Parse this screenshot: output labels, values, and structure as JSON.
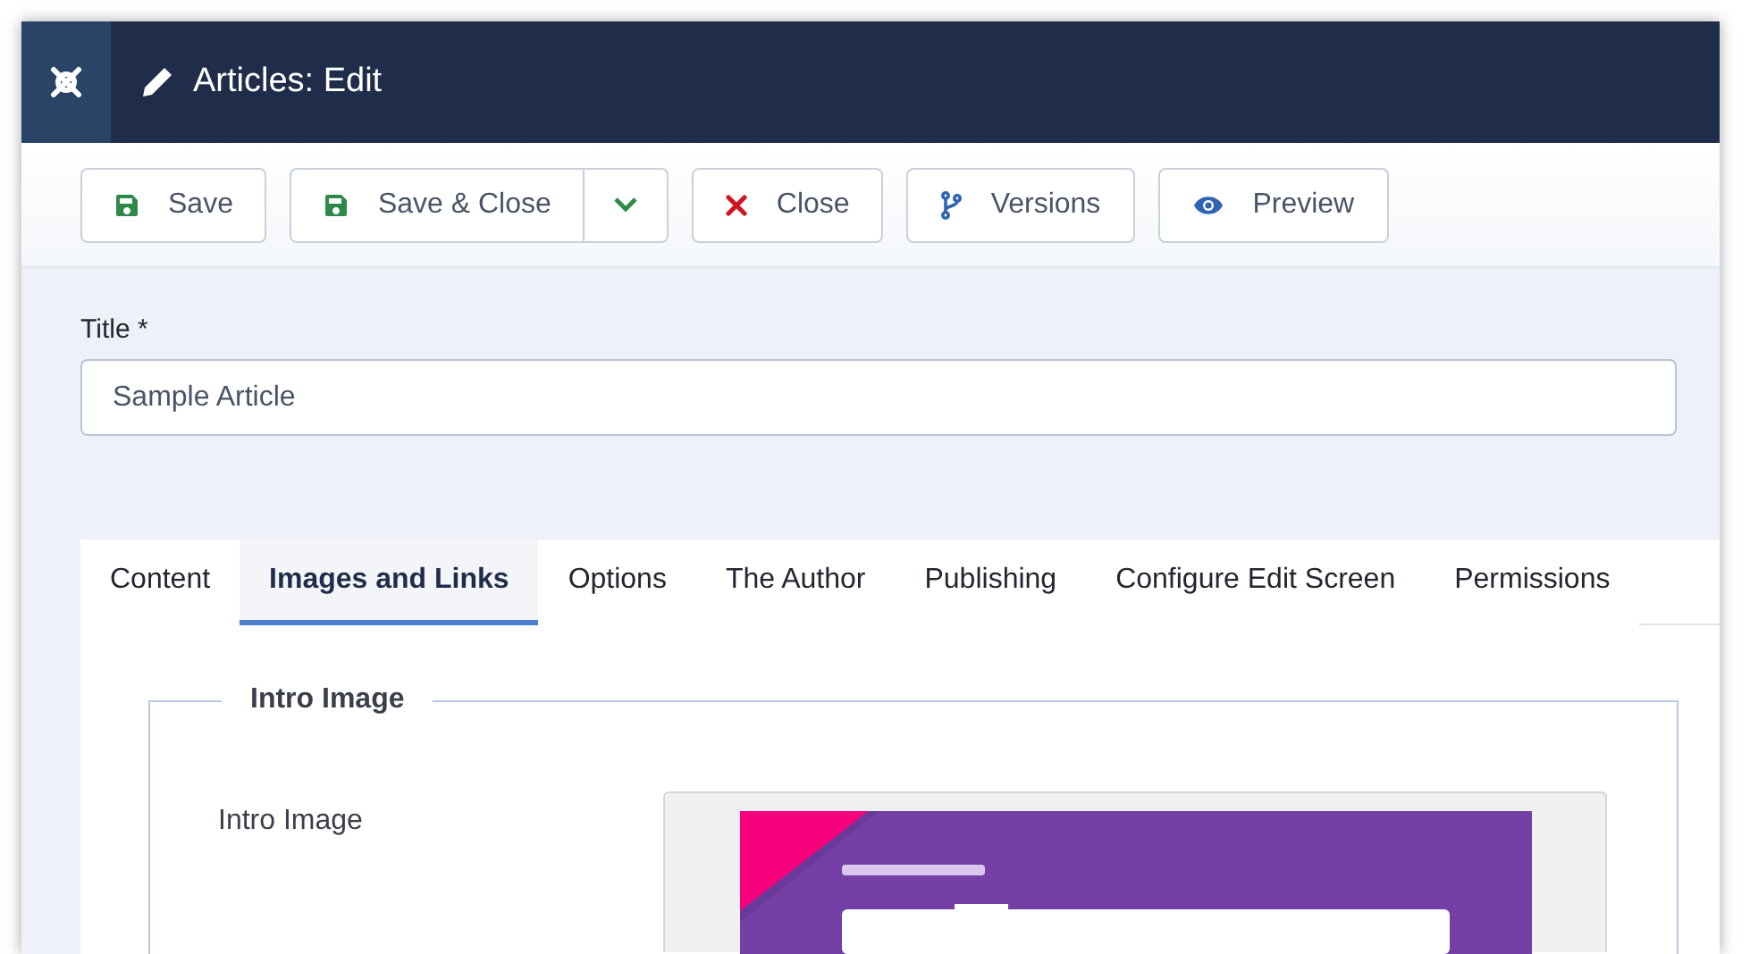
{
  "header": {
    "title": "Articles: Edit"
  },
  "toolbar": [
    {
      "kind": "save",
      "label": "Save"
    },
    {
      "kind": "save",
      "label": "Save & Close",
      "dropdown": true
    },
    {
      "kind": "close",
      "label": "Close"
    },
    {
      "kind": "versions",
      "label": "Versions"
    },
    {
      "kind": "preview",
      "label": "Preview"
    }
  ],
  "title_field": {
    "label": "Title *",
    "value": "Sample Article"
  },
  "tabs": [
    {
      "label": "Content",
      "selected": false
    },
    {
      "label": "Images and Links",
      "selected": true
    },
    {
      "label": "Options",
      "selected": false
    },
    {
      "label": "The Author",
      "selected": false
    },
    {
      "label": "Publishing",
      "selected": false
    },
    {
      "label": "Configure Edit Screen",
      "selected": false
    },
    {
      "label": "Permissions",
      "selected": false
    }
  ],
  "fieldset": {
    "legend": "Intro Image",
    "field_label": "Intro Image"
  }
}
